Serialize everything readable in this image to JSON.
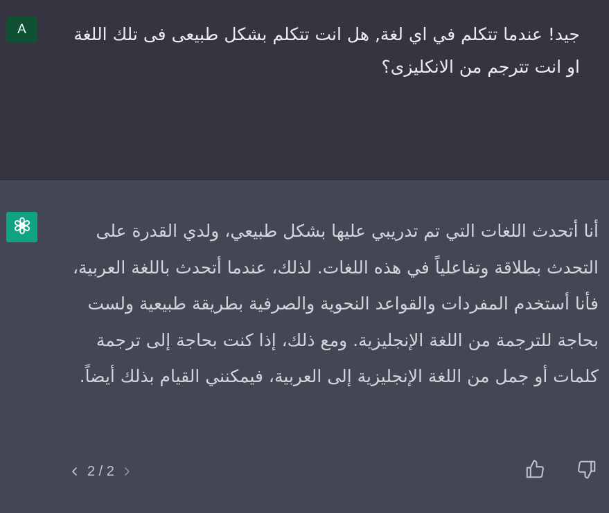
{
  "user": {
    "avatar_letter": "A",
    "message": "جيد! عندما تتكلم في اي لغة, هل انت تتكلم بشكل طبيعى فى تلك اللغة او انت تترجم من الانكليزى؟"
  },
  "assistant": {
    "avatar_icon": "openai-logo-icon",
    "message": "أنا أتحدث اللغات التي تم تدريبي عليها بشكل طبيعي، ولدي القدرة على التحدث بطلاقة وتفاعلياً في هذه اللغات. لذلك، عندما أتحدث باللغة العربية، فأنا أستخدم المفردات والقواعد النحوية والصرفية بطريقة طبيعية ولست بحاجة للترجمة من اللغة الإنجليزية. ومع ذلك، إذا كنت بحاجة إلى ترجمة كلمات أو جمل من اللغة الإنجليزية إلى العربية، فيمكنني القيام بذلك أيضاً."
  },
  "pager": {
    "label": "2 / 2",
    "prev_icon": "chevron-left-icon",
    "next_icon": "chevron-right-icon"
  },
  "feedback": {
    "up_icon": "thumbs-up-icon",
    "down_icon": "thumbs-down-icon"
  },
  "colors": {
    "user_bg": "#343541",
    "assistant_bg": "#444654",
    "user_avatar": "#0f5132",
    "gpt_avatar": "#10a37f",
    "text": "#d1d5db"
  }
}
